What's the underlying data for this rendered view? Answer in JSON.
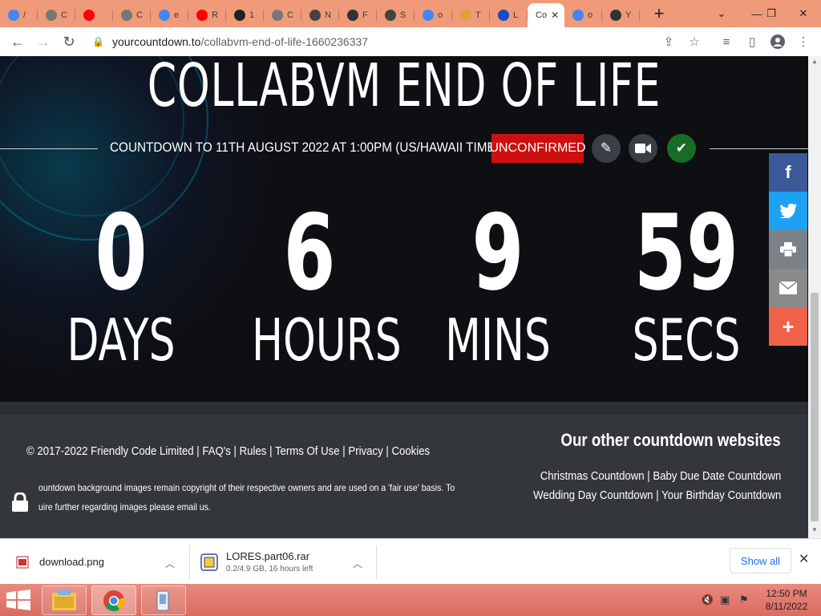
{
  "browser": {
    "tabs": [
      {
        "icon": "google-icon",
        "label": "/",
        "color": "#4285f4"
      },
      {
        "icon": "chrome-generic-icon",
        "label": "C",
        "color": "#777777"
      },
      {
        "icon": "youtube-icon",
        "label": "",
        "color": "#ff0000"
      },
      {
        "icon": "chrome-generic-icon",
        "label": "C",
        "color": "#777777"
      },
      {
        "icon": "google-icon",
        "label": "e",
        "color": "#4285f4"
      },
      {
        "icon": "youtube-icon",
        "label": "R",
        "color": "#ff0000"
      },
      {
        "icon": "drive-icon",
        "label": "1",
        "color": "#222222"
      },
      {
        "icon": "chrome-generic-icon",
        "label": "C",
        "color": "#777777"
      },
      {
        "icon": "github-icon",
        "label": "N",
        "color": "#444444"
      },
      {
        "icon": "timer-icon",
        "label": "F",
        "color": "#333333"
      },
      {
        "icon": "smiley-icon",
        "label": "S",
        "color": "#444444"
      },
      {
        "icon": "google-icon",
        "label": "o",
        "color": "#4285f4"
      },
      {
        "icon": "mail-icon",
        "label": "T",
        "color": "#e0a040"
      },
      {
        "icon": "l-icon",
        "label": "L",
        "color": "#1a4ac0"
      },
      {
        "icon": "",
        "label": "Co",
        "color": "#ffffff",
        "active": true
      },
      {
        "icon": "google-icon",
        "label": "o",
        "color": "#4285f4"
      },
      {
        "icon": "timer-icon",
        "label": "Y",
        "color": "#333333"
      }
    ],
    "url_host": "yourcountdown.to",
    "url_path": "/collabvm-end-of-life-1660236337"
  },
  "page": {
    "title": "COLLABVM END OF LIFE",
    "subtitle": "COUNTDOWN TO 11TH AUGUST 2022 AT 1:00PM (US/HAWAII TIME)",
    "status_badge": "UNCONFIRMED",
    "status_color": "#cc1010",
    "countdown": [
      {
        "value": "0",
        "label": "DAYS"
      },
      {
        "value": "6",
        "label": "HOURS"
      },
      {
        "value": "9",
        "label": "MINS"
      },
      {
        "value": "59",
        "label": "SECS"
      }
    ],
    "share_colors": {
      "facebook": "#3b5998",
      "twitter": "#1da1f2",
      "print": "#7b8287",
      "email": "#8a8a8a",
      "more": "#f0604a"
    }
  },
  "footer": {
    "copyright": "© 2017-2022 Friendly Code Limited",
    "links": [
      "FAQ's",
      "Rules",
      "Terms Of Use",
      "Privacy",
      "Cookies"
    ],
    "disclaimer_line1": "ountdown background images remain copyright of their respective owners and are used on a 'fair use' basis. To",
    "disclaimer_line2": "uire further regarding images please email us.",
    "other_title": "Our other countdown websites",
    "other_links_line1": [
      "Christmas Countdown",
      "Baby Due Date Countdown"
    ],
    "other_links_line2": [
      "Wedding Day Countdown",
      "Your Birthday Countdown"
    ]
  },
  "downloads": {
    "items": [
      {
        "name": "download.png",
        "status": ""
      },
      {
        "name": "LORES.part06.rar",
        "status": "0.2/4.9 GB, 16 hours left"
      }
    ],
    "show_all": "Show all"
  },
  "taskbar": {
    "time": "12:50 PM",
    "date": "8/11/2022"
  }
}
